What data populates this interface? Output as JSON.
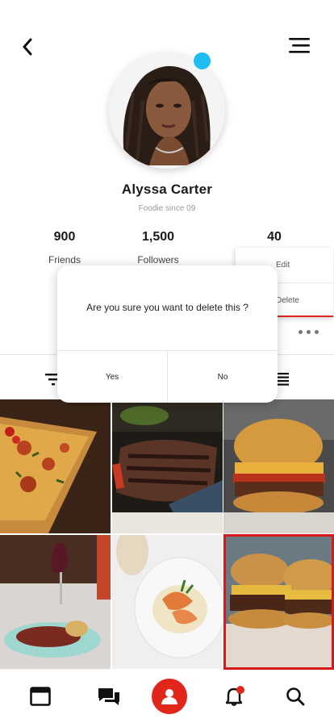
{
  "accent_color": "#e1261c",
  "online_color": "#1ebdf3",
  "profile": {
    "name": "Alyssa Carter",
    "subtitle": "Foodie since 09"
  },
  "stats": [
    {
      "value": "900",
      "label": "Friends"
    },
    {
      "value": "1,500",
      "label": "Followers"
    },
    {
      "value": "40",
      "label": ""
    }
  ],
  "context_menu": {
    "items": [
      "Edit",
      "Delete"
    ]
  },
  "dialog": {
    "message": "Are you sure you want to delete this ?",
    "confirm_label": "Yes",
    "cancel_label": "No"
  },
  "icons": {
    "back": "chevron-left-icon",
    "menu": "hamburger-menu-icon",
    "more": "more-horizontal-icon",
    "filter": "filter-icon",
    "list": "list-view-icon"
  },
  "gallery": [
    {
      "subject": "pizza"
    },
    {
      "subject": "steak"
    },
    {
      "subject": "burger"
    },
    {
      "subject": "octopus"
    },
    {
      "subject": "shrimp"
    },
    {
      "subject": "burger"
    }
  ],
  "tabbar": {
    "items": [
      "feed-icon",
      "chat-icon",
      "profile-icon",
      "notification-icon",
      "search-icon"
    ],
    "active": "profile-icon"
  }
}
